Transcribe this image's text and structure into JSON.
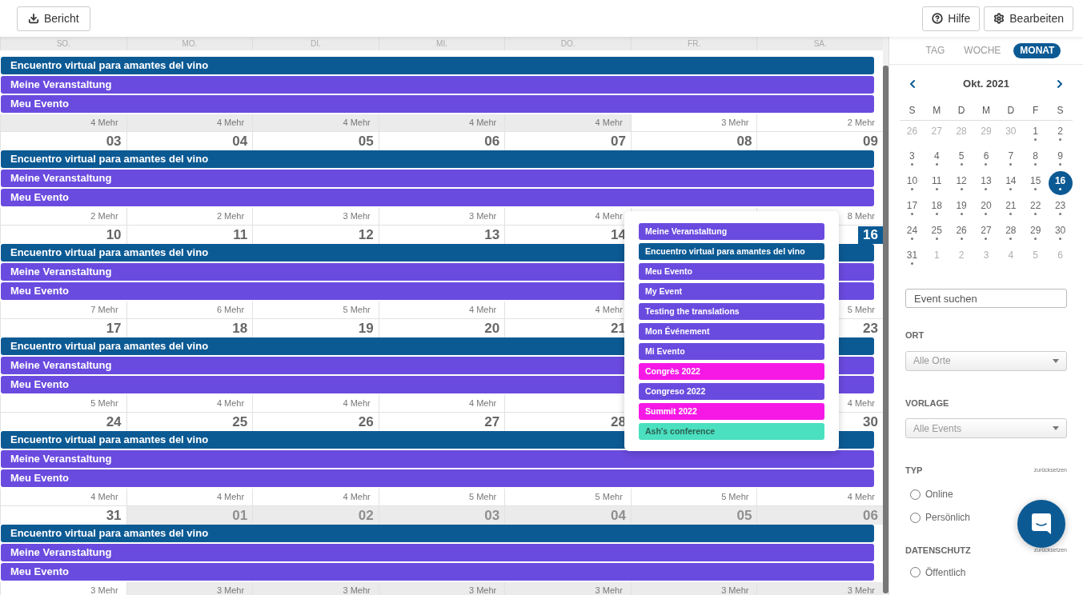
{
  "toolbar": {
    "report_button": "Bericht",
    "help_button": "Hilfe",
    "edit_button": "Bearbeiten"
  },
  "weekdays": [
    "SO.",
    "MO.",
    "DI.",
    "MI.",
    "DO.",
    "FR.",
    "SA."
  ],
  "weeks": [
    {
      "days": [
        {
          "outside": true,
          "more": "4 Mehr"
        },
        {
          "outside": true,
          "more": "4 Mehr"
        },
        {
          "outside": true,
          "more": "4 Mehr"
        },
        {
          "outside": true,
          "more": "4 Mehr"
        },
        {
          "outside": true,
          "more": "4 Mehr"
        },
        {
          "outside": false,
          "more": "3 Mehr"
        },
        {
          "outside": false,
          "more": "2 Mehr"
        }
      ],
      "events": [
        {
          "title": "Encuentro virtual para amantes del vino",
          "color": "#0c5a94"
        },
        {
          "title": "Meine Veranstaltung",
          "color": "#6a4bdf"
        },
        {
          "title": "Meu Evento",
          "color": "#6a4bdf"
        }
      ]
    },
    {
      "days": [
        {
          "date": "03",
          "outside": false,
          "today": false,
          "more": "2 Mehr"
        },
        {
          "date": "04",
          "outside": false,
          "today": false,
          "more": "2 Mehr"
        },
        {
          "date": "05",
          "outside": false,
          "today": false,
          "more": "3 Mehr"
        },
        {
          "date": "06",
          "outside": false,
          "today": false,
          "more": "3 Mehr"
        },
        {
          "date": "07",
          "outside": false,
          "today": false,
          "more": "4 Mehr"
        },
        {
          "date": "08",
          "outside": false,
          "today": false
        },
        {
          "date": "09",
          "outside": false,
          "today": false,
          "more": "8 Mehr"
        }
      ],
      "events": [
        {
          "title": "Encuentro virtual para amantes del vino",
          "color": "#0c5a94"
        },
        {
          "title": "Meine Veranstaltung",
          "color": "#6a4bdf"
        },
        {
          "title": "Meu Evento",
          "color": "#6a4bdf"
        }
      ]
    },
    {
      "days": [
        {
          "kind": "day",
          "date": "10",
          "outside": false,
          "today": false,
          "more": "7 Mehr"
        },
        {
          "kind": "day",
          "date": "11",
          "outside": false,
          "today": false,
          "more": "6 Mehr"
        },
        {
          "kind": "day",
          "date": "12",
          "outside": false,
          "today": false,
          "more": "5 Mehr"
        },
        {
          "kind": "day",
          "date": "13",
          "outside": false,
          "today": false,
          "more": "4 Mehr"
        },
        {
          "kind": "day",
          "date": "14",
          "outside": false,
          "today": false,
          "more": "4 Mehr"
        },
        {
          "kind": "covered"
        },
        {
          "kind": "day",
          "date": "16",
          "outside": false,
          "today": true,
          "more": "5 Mehr"
        }
      ],
      "events": [
        {
          "title": "Encuentro virtual para amantes del vino",
          "color": "#0c5a94"
        },
        {
          "title": "Meine Veranstaltung",
          "color": "#6a4bdf"
        },
        {
          "title": "Meu Evento",
          "color": "#6a4bdf"
        }
      ]
    },
    {
      "days": [
        {
          "kind": "day",
          "date": "17",
          "outside": false,
          "today": false,
          "more": "5 Mehr"
        },
        {
          "kind": "day",
          "date": "18",
          "outside": false,
          "today": false,
          "more": "4 Mehr"
        },
        {
          "kind": "day",
          "date": "19",
          "outside": false,
          "today": false,
          "more": "4 Mehr"
        },
        {
          "kind": "day",
          "date": "20",
          "outside": false,
          "today": false,
          "more": "4 Mehr"
        },
        {
          "kind": "day",
          "date": "21",
          "outside": false,
          "today": false
        },
        {
          "kind": "covered"
        },
        {
          "kind": "day",
          "date": "23",
          "outside": false,
          "today": false,
          "more": "4 Mehr"
        }
      ],
      "events": [
        {
          "title": "Encuentro virtual para amantes del vino",
          "color": "#0c5a94"
        },
        {
          "title": "Meine Veranstaltung",
          "color": "#6a4bdf"
        },
        {
          "title": "Meu Evento",
          "color": "#6a4bdf"
        }
      ]
    },
    {
      "days": [
        {
          "date": "24",
          "outside": false,
          "today": false,
          "more": "4 Mehr"
        },
        {
          "date": "25",
          "outside": false,
          "today": false,
          "more": "4 Mehr"
        },
        {
          "date": "26",
          "outside": false,
          "today": false,
          "more": "4 Mehr"
        },
        {
          "date": "27",
          "outside": false,
          "today": false,
          "more": "5 Mehr"
        },
        {
          "date": "28",
          "outside": false,
          "today": false,
          "more": "5 Mehr"
        },
        {
          "outside": false,
          "more": "5 Mehr"
        },
        {
          "date": "30",
          "outside": false,
          "today": false,
          "more": "4 Mehr"
        }
      ],
      "events": [
        {
          "title": "Encuentro virtual para amantes del vino",
          "color": "#0c5a94"
        },
        {
          "title": "Meine Veranstaltung",
          "color": "#6a4bdf"
        },
        {
          "title": "Meu Evento",
          "color": "#6a4bdf"
        }
      ]
    },
    {
      "days": [
        {
          "date": "31",
          "outside": false,
          "today": false,
          "more": "3 Mehr"
        },
        {
          "date": "01",
          "outside": true,
          "today": false,
          "more": "3 Mehr"
        },
        {
          "date": "02",
          "outside": true,
          "today": false,
          "more": "3 Mehr"
        },
        {
          "date": "03",
          "outside": true,
          "today": false,
          "more": "3 Mehr"
        },
        {
          "date": "04",
          "outside": true,
          "today": false,
          "more": "3 Mehr"
        },
        {
          "date": "05",
          "outside": true,
          "today": false,
          "more": "3 Mehr"
        },
        {
          "date": "06",
          "outside": true,
          "today": false,
          "more": "3 Mehr"
        }
      ],
      "events": [
        {
          "title": "Encuentro virtual para amantes del vino",
          "color": "#0c5a94"
        },
        {
          "title": "Meine Veranstaltung",
          "color": "#6a4bdf"
        },
        {
          "title": "Meu Evento",
          "color": "#6a4bdf"
        }
      ]
    }
  ],
  "popover": {
    "events": [
      {
        "title": "Meine Veranstaltung",
        "color": "#6a4bdf"
      },
      {
        "title": "Encuentro virtual para amantes del vino",
        "color": "#0c5a94"
      },
      {
        "title": "Meu Evento",
        "color": "#6a4bdf"
      },
      {
        "title": "My Event",
        "color": "#6a4bdf"
      },
      {
        "title": "Testing the translations",
        "color": "#6a4bdf"
      },
      {
        "title": "Mon Événement",
        "color": "#6a4bdf"
      },
      {
        "title": "Mi Evento",
        "color": "#6a4bdf"
      },
      {
        "title": "Congrès 2022",
        "color": "#f619e6"
      },
      {
        "title": "Congreso 2022",
        "color": "#6a4bdf"
      },
      {
        "title": "Summit 2022",
        "color": "#f619e6"
      },
      {
        "title": "Ash's conference",
        "color": "#4ae0c0"
      }
    ]
  },
  "sidebar": {
    "views": [
      {
        "label": "TAG",
        "selected": false
      },
      {
        "label": "WOCHE",
        "selected": false
      },
      {
        "label": "MONAT",
        "selected": true
      }
    ],
    "mini_calendar": {
      "title": "Okt. 2021",
      "weekdays": [
        "S",
        "M",
        "D",
        "M",
        "D",
        "F",
        "S"
      ],
      "weeks": [
        [
          {
            "day": "26",
            "outside": true,
            "has_events": false,
            "selected": false
          },
          {
            "day": "27",
            "outside": true,
            "has_events": false,
            "selected": false
          },
          {
            "day": "28",
            "outside": true,
            "has_events": false,
            "selected": false
          },
          {
            "day": "29",
            "outside": true,
            "has_events": false,
            "selected": false
          },
          {
            "day": "30",
            "outside": true,
            "has_events": false,
            "selected": false
          },
          {
            "day": "1",
            "outside": false,
            "has_events": true,
            "selected": false
          },
          {
            "day": "2",
            "outside": false,
            "has_events": true,
            "selected": false
          }
        ],
        [
          {
            "day": "3",
            "outside": false,
            "has_events": true,
            "selected": false
          },
          {
            "day": "4",
            "outside": false,
            "has_events": true,
            "selected": false
          },
          {
            "day": "5",
            "outside": false,
            "has_events": true,
            "selected": false
          },
          {
            "day": "6",
            "outside": false,
            "has_events": true,
            "selected": false
          },
          {
            "day": "7",
            "outside": false,
            "has_events": true,
            "selected": false
          },
          {
            "day": "8",
            "outside": false,
            "has_events": true,
            "selected": false
          },
          {
            "day": "9",
            "outside": false,
            "has_events": true,
            "selected": false
          }
        ],
        [
          {
            "day": "10",
            "outside": false,
            "has_events": true,
            "selected": false
          },
          {
            "day": "11",
            "outside": false,
            "has_events": true,
            "selected": false
          },
          {
            "day": "12",
            "outside": false,
            "has_events": true,
            "selected": false
          },
          {
            "day": "13",
            "outside": false,
            "has_events": true,
            "selected": false
          },
          {
            "day": "14",
            "outside": false,
            "has_events": true,
            "selected": false
          },
          {
            "day": "15",
            "outside": false,
            "has_events": true,
            "selected": false
          },
          {
            "day": "16",
            "outside": false,
            "has_events": true,
            "selected": true
          }
        ],
        [
          {
            "day": "17",
            "outside": false,
            "has_events": true,
            "selected": false
          },
          {
            "day": "18",
            "outside": false,
            "has_events": true,
            "selected": false
          },
          {
            "day": "19",
            "outside": false,
            "has_events": true,
            "selected": false
          },
          {
            "day": "20",
            "outside": false,
            "has_events": true,
            "selected": false
          },
          {
            "day": "21",
            "outside": false,
            "has_events": true,
            "selected": false
          },
          {
            "day": "22",
            "outside": false,
            "has_events": true,
            "selected": false
          },
          {
            "day": "23",
            "outside": false,
            "has_events": true,
            "selected": false
          }
        ],
        [
          {
            "day": "24",
            "outside": false,
            "has_events": true,
            "selected": false
          },
          {
            "day": "25",
            "outside": false,
            "has_events": true,
            "selected": false
          },
          {
            "day": "26",
            "outside": false,
            "has_events": true,
            "selected": false
          },
          {
            "day": "27",
            "outside": false,
            "has_events": true,
            "selected": false
          },
          {
            "day": "28",
            "outside": false,
            "has_events": true,
            "selected": false
          },
          {
            "day": "29",
            "outside": false,
            "has_events": true,
            "selected": false
          },
          {
            "day": "30",
            "outside": false,
            "has_events": true,
            "selected": false
          }
        ],
        [
          {
            "day": "31",
            "outside": false,
            "has_events": true,
            "selected": false
          },
          {
            "day": "1",
            "outside": true,
            "has_events": false,
            "selected": false
          },
          {
            "day": "2",
            "outside": true,
            "has_events": false,
            "selected": false
          },
          {
            "day": "3",
            "outside": true,
            "has_events": false,
            "selected": false
          },
          {
            "day": "4",
            "outside": true,
            "has_events": false,
            "selected": false
          },
          {
            "day": "5",
            "outside": true,
            "has_events": false,
            "selected": false
          },
          {
            "day": "6",
            "outside": true,
            "has_events": false,
            "selected": false
          }
        ]
      ]
    },
    "search": {
      "placeholder": "Event suchen"
    },
    "location": {
      "label": "ORT",
      "value": "Alle Orte"
    },
    "template": {
      "label": "VORLAGE",
      "value": "Alle Events"
    },
    "type": {
      "label": "TYP",
      "reset": "zurücksetzen",
      "options": [
        {
          "label": "Online",
          "selected": false
        },
        {
          "label": "Persönlich",
          "selected": false
        }
      ]
    },
    "privacy": {
      "label": "DATENSCHUTZ",
      "reset": "zurücksetzen",
      "options": [
        {
          "label": "Öffentlich",
          "selected": false
        }
      ]
    }
  }
}
